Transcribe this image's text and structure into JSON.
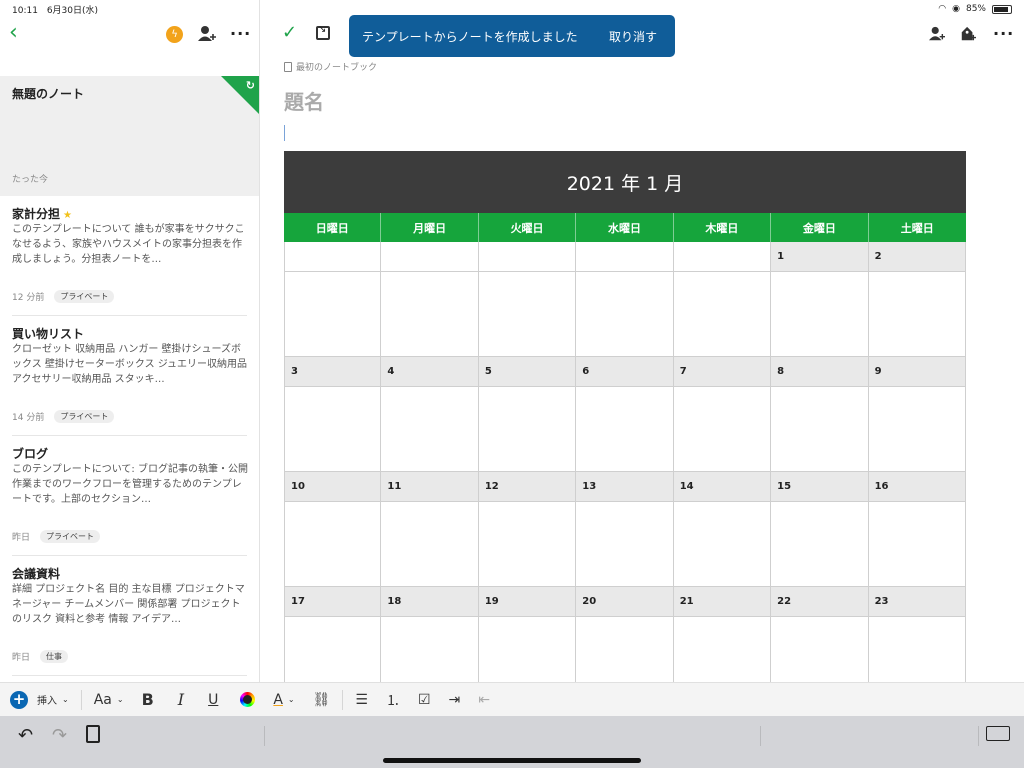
{
  "status_bar": {
    "time": "10:11",
    "date": "6月30日(水)",
    "battery": "85%",
    "battery_level": 0.85
  },
  "sidebar": {
    "selected_note": {
      "title": "無題のノート",
      "time": "たった今"
    },
    "notes": [
      {
        "title": "家計分担",
        "starred": true,
        "snippet": "このテンプレートについて 誰もが家事をサクサクこなせるよう、家族やハウスメイトの家事分担表を作成しましょう。分担表ノートを…",
        "time": "12 分前",
        "tag": "プライベート"
      },
      {
        "title": "買い物リスト",
        "starred": false,
        "snippet": "クローゼット 収納用品 ハンガー 壁掛けシューズボックス 壁掛けセーターボックス ジュエリー収納用品 アクセサリー収納用品 スタッキ…",
        "time": "14 分前",
        "tag": "プライベート"
      },
      {
        "title": "ブログ",
        "starred": false,
        "snippet": "このテンプレートについて: ブログ記事の執筆・公開作業までのワークフローを管理するためのテンプレートです。上部のセクション…",
        "time": "昨日",
        "tag": "プライベート"
      },
      {
        "title": "会議資料",
        "starred": false,
        "snippet": "詳細 プロジェクト名 目的 主な目標 プロジェクトマネージャー チームメンバー 関係部署 プロジェクトのリスク 資料と参考 情報 アイデア…",
        "time": "昨日",
        "tag": "仕事"
      }
    ]
  },
  "editor": {
    "toast": {
      "message": "テンプレートからノートを作成しました",
      "action": "取り消す"
    },
    "notebook": "最初のノートブック",
    "title_placeholder": "題名",
    "calendar": {
      "heading": "2021 年 1 月",
      "weekdays": [
        "日曜日",
        "月曜日",
        "火曜日",
        "水曜日",
        "木曜日",
        "金曜日",
        "土曜日"
      ],
      "weeks": [
        [
          "",
          "",
          "",
          "",
          "",
          "1",
          "2"
        ],
        [
          "3",
          "4",
          "5",
          "6",
          "7",
          "8",
          "9"
        ],
        [
          "10",
          "11",
          "12",
          "13",
          "14",
          "15",
          "16"
        ],
        [
          "17",
          "18",
          "19",
          "20",
          "21",
          "22",
          "23"
        ]
      ]
    }
  },
  "format_toolbar": {
    "insert_label": "挿入",
    "font_label": "Aa",
    "bold": "B",
    "italic": "I",
    "underline": "U",
    "highlight": "A"
  },
  "colors": {
    "accent_green": "#1fa34a",
    "toast_blue": "#105d99",
    "calendar_header": "#3c3c3c",
    "weekday_bar": "#16a53c"
  }
}
